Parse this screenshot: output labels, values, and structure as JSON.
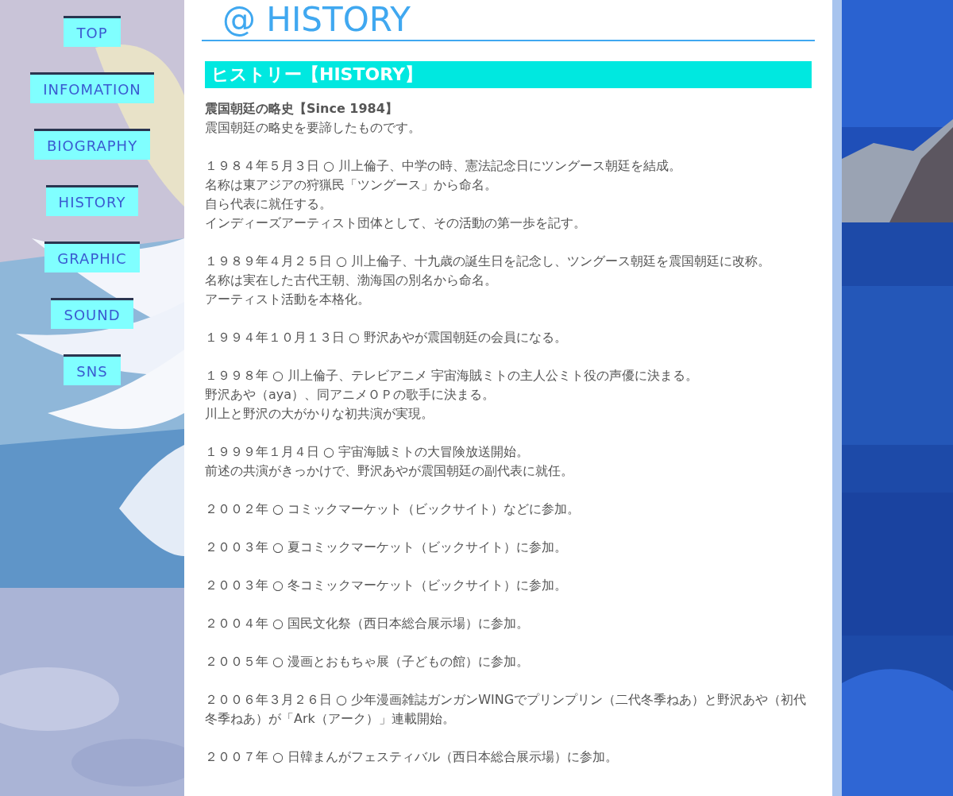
{
  "nav": [
    {
      "label": "TOP"
    },
    {
      "label": "INFOMATION"
    },
    {
      "label": "BIOGRAPHY"
    },
    {
      "label": "HISTORY"
    },
    {
      "label": "GRAPHIC"
    },
    {
      "label": "SOUND"
    },
    {
      "label": "SNS"
    }
  ],
  "page_title": "@ HISTORY",
  "section_heading": "ヒストリー【HISTORY】",
  "intro_title": "震国朝廷の略史【Since 1984】",
  "intro_text": "震国朝廷の略史を要諦したものです。",
  "entries": [
    {
      "lines": [
        "１９８４年５月３日 ○ 川上倫子、中学の時、憲法記念日にツングース朝廷を結成。",
        "名称は東アジアの狩猟民「ツングース」から命名。",
        "自ら代表に就任する。",
        "インディーズアーティスト団体として、その活動の第一歩を記す。"
      ]
    },
    {
      "lines": [
        "１９８９年４月２５日 ○ 川上倫子、十九歳の誕生日を記念し、ツングース朝廷を震国朝廷に改称。",
        "名称は実在した古代王朝、渤海国の別名から命名。",
        "アーティスト活動を本格化。"
      ]
    },
    {
      "lines": [
        "１９９４年１０月１３日 ○ 野沢あやが震国朝廷の会員になる。"
      ]
    },
    {
      "lines": [
        "１９９８年 ○ 川上倫子、テレビアニメ 宇宙海賊ミトの主人公ミト役の声優に決まる。",
        "野沢あや（aya）、同アニメＯＰの歌手に決まる。",
        "川上と野沢の大がかりな初共演が実現。"
      ]
    },
    {
      "lines": [
        "１９９９年１月４日 ○ 宇宙海賊ミトの大冒険放送開始。",
        "前述の共演がきっかけで、野沢あやが震国朝廷の副代表に就任。"
      ]
    },
    {
      "lines": [
        "２００２年 ○ コミックマーケット（ビックサイト）などに参加。"
      ]
    },
    {
      "lines": [
        "２００３年 ○ 夏コミックマーケット（ビックサイト）に参加。"
      ]
    },
    {
      "lines": [
        "２００３年 ○ 冬コミックマーケット（ビックサイト）に参加。"
      ]
    },
    {
      "lines": [
        "２００４年 ○ 国民文化祭（西日本総合展示場）に参加。"
      ]
    },
    {
      "lines": [
        "２００５年 ○ 漫画とおもちゃ展（子どもの館）に参加。"
      ]
    },
    {
      "lines": [
        "２００６年３月２６日 ○ 少年漫画雑誌ガンガンWINGでプリンプリン（二代冬季ねあ）と野沢あや（初代冬季ねあ）が「Ark（アーク）」連載開始。"
      ]
    },
    {
      "lines": [
        "２００７年 ○ 日韓まんがフェスティバル（西日本総合展示場）に参加。"
      ]
    }
  ]
}
